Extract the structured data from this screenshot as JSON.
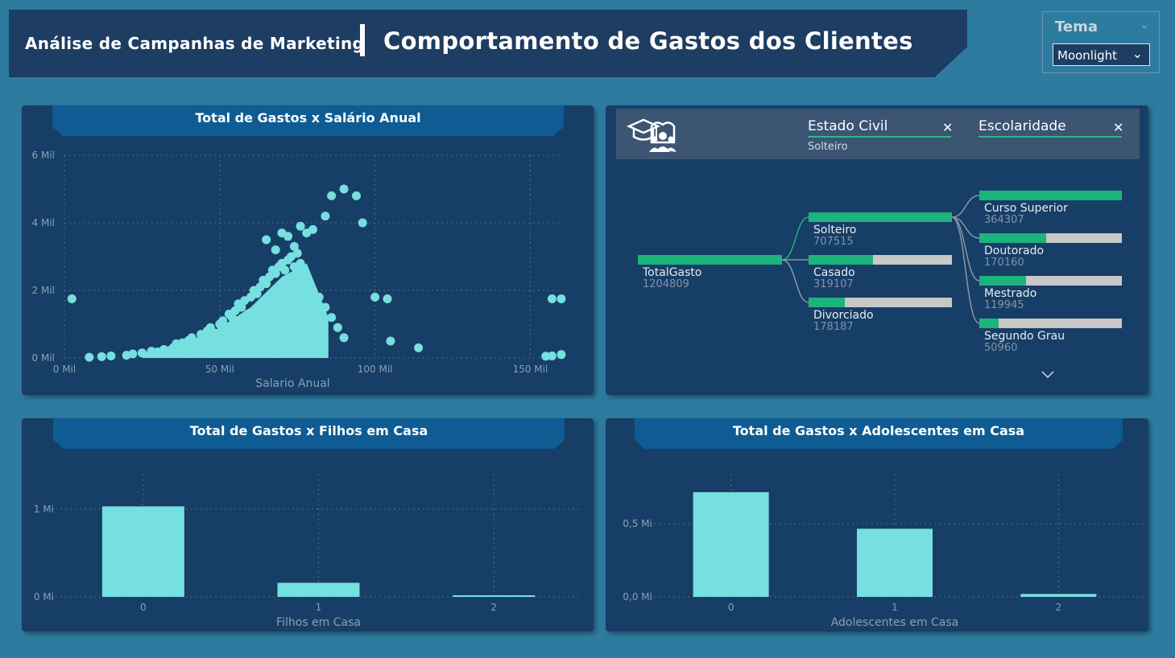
{
  "header": {
    "subtitle": "Análise de Campanhas de Marketing",
    "title": "Comportamento de Gastos dos Clientes"
  },
  "theme_selector": {
    "label": "Tema",
    "selected": "Moonlight"
  },
  "colors": {
    "background": "#2e7ba0",
    "panel": "#173e66",
    "title_strip": "#0e5c93",
    "mark": "#76dfe0",
    "tree_fill": "#1db37c",
    "tree_rest": "#c8c8c8"
  },
  "decomp_tree": {
    "icon": "graduation-people-icon",
    "filters": [
      {
        "field": "Estado Civil",
        "value": "Solteiro"
      },
      {
        "field": "Escolaridade",
        "value": ""
      }
    ],
    "root": {
      "name": "TotalGasto",
      "value": "1204809"
    },
    "level1": [
      {
        "name": "Solteiro",
        "value": "707515",
        "fraction": 1.0
      },
      {
        "name": "Casado",
        "value": "319107",
        "fraction": 0.45
      },
      {
        "name": "Divorciado",
        "value": "178187",
        "fraction": 0.25
      }
    ],
    "level2": [
      {
        "name": "Curso Superior",
        "value": "364307",
        "fraction": 1.0
      },
      {
        "name": "Doutorado",
        "value": "170160",
        "fraction": 0.47
      },
      {
        "name": "Mestrado",
        "value": "119945",
        "fraction": 0.33
      },
      {
        "name": "Segundo Grau",
        "value": "50960",
        "fraction": 0.14
      }
    ]
  },
  "chart_data": [
    {
      "type": "scatter",
      "title": "Total de Gastos x Salário Anual",
      "xlabel": "Salario Anual",
      "ylabel": "",
      "xticks": [
        "0 Mil",
        "50 Mil",
        "100 Mil",
        "150 Mil"
      ],
      "yticks": [
        "0 Mil",
        "2 Mil",
        "4 Mil",
        "6 Mil"
      ],
      "xlim": [
        0,
        160000
      ],
      "ylim": [
        0,
        6000
      ],
      "points": [
        [
          2400,
          1750
        ],
        [
          8000,
          20
        ],
        [
          12000,
          40
        ],
        [
          15000,
          60
        ],
        [
          20000,
          80
        ],
        [
          22000,
          120
        ],
        [
          25000,
          150
        ],
        [
          28000,
          200
        ],
        [
          30000,
          180
        ],
        [
          32000,
          250
        ],
        [
          35000,
          300
        ],
        [
          36000,
          420
        ],
        [
          38000,
          450
        ],
        [
          40000,
          520
        ],
        [
          41000,
          600
        ],
        [
          42000,
          400
        ],
        [
          44000,
          700
        ],
        [
          45000,
          650
        ],
        [
          46000,
          800
        ],
        [
          47000,
          900
        ],
        [
          48000,
          750
        ],
        [
          50000,
          1000
        ],
        [
          51000,
          1100
        ],
        [
          52000,
          900
        ],
        [
          53000,
          1300
        ],
        [
          54000,
          1200
        ],
        [
          55000,
          1400
        ],
        [
          56000,
          1600
        ],
        [
          57000,
          1500
        ],
        [
          58000,
          1700
        ],
        [
          59000,
          1300
        ],
        [
          60000,
          1800
        ],
        [
          61000,
          2000
        ],
        [
          62000,
          1900
        ],
        [
          63000,
          2100
        ],
        [
          64000,
          2300
        ],
        [
          65000,
          2200
        ],
        [
          66000,
          2400
        ],
        [
          67000,
          2600
        ],
        [
          68000,
          2500
        ],
        [
          69000,
          2700
        ],
        [
          70000,
          2800
        ],
        [
          71000,
          2600
        ],
        [
          72000,
          2900
        ],
        [
          73000,
          3000
        ],
        [
          74000,
          2700
        ],
        [
          75000,
          3100
        ],
        [
          76000,
          2800
        ],
        [
          77000,
          2500
        ],
        [
          78000,
          2300
        ],
        [
          80000,
          2000
        ],
        [
          82000,
          1800
        ],
        [
          84000,
          1500
        ],
        [
          86000,
          1200
        ],
        [
          88000,
          900
        ],
        [
          90000,
          600
        ],
        [
          65000,
          3500
        ],
        [
          68000,
          3200
        ],
        [
          70000,
          3700
        ],
        [
          72000,
          3600
        ],
        [
          74000,
          3300
        ],
        [
          76000,
          3900
        ],
        [
          78000,
          3700
        ],
        [
          80000,
          3800
        ],
        [
          86000,
          4800
        ],
        [
          90000,
          5000
        ],
        [
          94000,
          4800
        ],
        [
          96000,
          4000
        ],
        [
          84000,
          4200
        ],
        [
          100000,
          1800
        ],
        [
          104000,
          1750
        ],
        [
          105000,
          500
        ],
        [
          114000,
          300
        ],
        [
          155000,
          50
        ],
        [
          157000,
          1750
        ],
        [
          160000,
          1750
        ],
        [
          160000,
          100
        ],
        [
          157000,
          60
        ]
      ],
      "density_curve": {
        "lower": [
          [
            25000,
            0
          ],
          [
            50000,
            0
          ],
          [
            80000,
            0
          ],
          [
            85000,
            0
          ]
        ],
        "upper": [
          [
            25000,
            150
          ],
          [
            40000,
            500
          ],
          [
            50000,
            900
          ],
          [
            60000,
            1500
          ],
          [
            70000,
            2400
          ],
          [
            78000,
            2800
          ],
          [
            85000,
            1200
          ]
        ]
      }
    },
    {
      "type": "bar",
      "title": "Total de Gastos x Filhos em Casa",
      "xlabel": "Filhos em Casa",
      "ylabel": "",
      "categories": [
        "0",
        "1",
        "2"
      ],
      "values": [
        1030000,
        160000,
        10000
      ],
      "yticks": [
        "0 Mi",
        "1 Mi"
      ],
      "ylim": [
        0,
        1300000
      ]
    },
    {
      "type": "bar",
      "title": "Total de Gastos x Adolescentes em Casa",
      "xlabel": "Adolescentes em Casa",
      "ylabel": "",
      "categories": [
        "0",
        "1",
        "2"
      ],
      "values": [
        715000,
        465000,
        20000
      ],
      "yticks": [
        "0,0 Mi",
        "0,5 Mi"
      ],
      "ylim": [
        0,
        780000
      ]
    }
  ]
}
